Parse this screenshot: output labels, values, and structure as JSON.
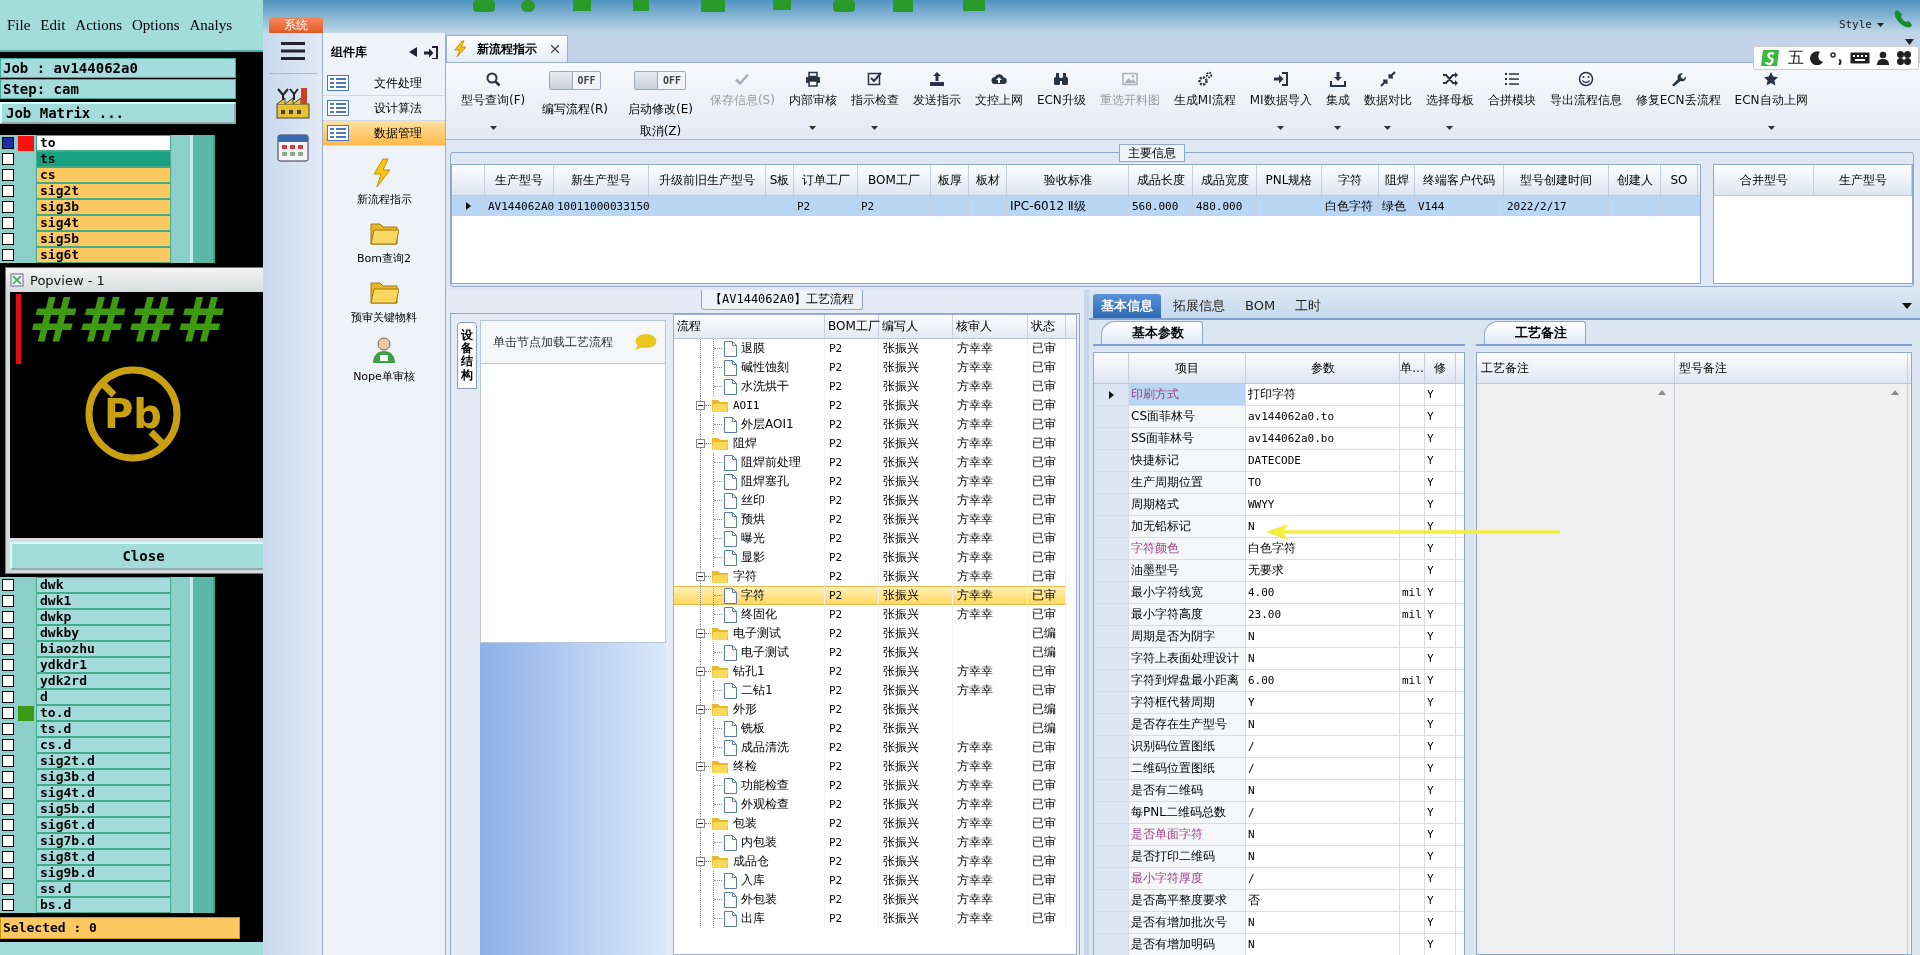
{
  "genesis": {
    "menu": [
      "File",
      "Edit",
      "Actions",
      "Options",
      "Analys"
    ],
    "job": "Job : av144062a0",
    "step": "Step: cam",
    "matrix_button": "Job Matrix ...",
    "layers_top": [
      {
        "label": "to",
        "color": "#ffffff",
        "marker": {
          "color": "#ff1010"
        },
        "selected": true
      },
      {
        "label": "ts",
        "color": "#18a080",
        "selected": false
      },
      {
        "label": "cs",
        "color": "#ffc860",
        "selected": false
      },
      {
        "label": "sig2t",
        "color": "#ffc860",
        "selected": false
      },
      {
        "label": "sig3b",
        "color": "#ffc860",
        "selected": false
      },
      {
        "label": "sig4t",
        "color": "#ffc860",
        "selected": false
      },
      {
        "label": "sig5b",
        "color": "#ffc860",
        "selected": false
      },
      {
        "label": "sig6t",
        "color": "#ffc860",
        "selected": false
      }
    ],
    "popview": {
      "title": "Popview - 1",
      "marks": "####",
      "symbol": "Pb",
      "close": "Close"
    },
    "layers_bottom": [
      {
        "label": "dwk",
        "color": "#a4dcdc",
        "selected": false
      },
      {
        "label": "dwk1",
        "color": "#a4dcdc",
        "selected": false
      },
      {
        "label": "dwkp",
        "color": "#a4dcdc",
        "selected": false
      },
      {
        "label": "dwkby",
        "color": "#a4dcdc",
        "selected": false
      },
      {
        "label": "biaozhu",
        "color": "#a4dcdc",
        "selected": false
      },
      {
        "label": "ydkdr1",
        "color": "#a4dcdc",
        "selected": false
      },
      {
        "label": "ydk2rd",
        "color": "#a4dcdc",
        "selected": false
      },
      {
        "label": "d",
        "color": "#a4dcdc",
        "selected": false
      },
      {
        "label": "to.d",
        "color": "#a4dcdc",
        "marker": {
          "color": "#3a9a18"
        },
        "selected": false
      },
      {
        "label": "ts.d",
        "color": "#a4dcdc",
        "selected": false
      },
      {
        "label": "cs.d",
        "color": "#a4dcdc",
        "selected": false
      },
      {
        "label": "sig2t.d",
        "color": "#a4dcdc",
        "selected": false
      },
      {
        "label": "sig3b.d",
        "color": "#a4dcdc",
        "selected": false
      },
      {
        "label": "sig4t.d",
        "color": "#a4dcdc",
        "selected": false
      },
      {
        "label": "sig5b.d",
        "color": "#a4dcdc",
        "selected": false
      },
      {
        "label": "sig6t.d",
        "color": "#a4dcdc",
        "selected": false
      },
      {
        "label": "sig7b.d",
        "color": "#a4dcdc",
        "selected": false
      },
      {
        "label": "sig8t.d",
        "color": "#a4dcdc",
        "selected": false
      },
      {
        "label": "sig9b.d",
        "color": "#a4dcdc",
        "selected": false
      },
      {
        "label": "ss.d",
        "color": "#a4dcdc",
        "selected": false
      },
      {
        "label": "bs.d",
        "color": "#a4dcdc",
        "selected": false
      }
    ],
    "status": "Selected : 0"
  },
  "app": {
    "system_tab": "系统",
    "style_menu": "Style",
    "ime_label": "五"
  },
  "sidebar": {
    "title": "组件库",
    "categories": [
      {
        "label": "文件处理",
        "selected": false
      },
      {
        "label": "设计算法",
        "selected": false
      },
      {
        "label": "数据管理",
        "selected": true
      }
    ],
    "tools": [
      {
        "label": "新流程指示",
        "kind": "lightning"
      },
      {
        "label": "Bom查询2",
        "kind": "folder"
      },
      {
        "label": "预审关键物料",
        "kind": "folder"
      },
      {
        "label": "Nope单审核",
        "kind": "person"
      }
    ]
  },
  "document_tab": {
    "label": "新流程指示"
  },
  "toolbar": [
    {
      "kind": "button",
      "label": "型号查询(F)",
      "dropdown": true,
      "disabled": false
    },
    {
      "kind": "toggle",
      "state": "OFF",
      "on": false,
      "label": "编写流程(R)"
    },
    {
      "kind": "toggle",
      "state": "OFF",
      "on": false,
      "label": "启动修改(E)",
      "label2": "取消(Z)"
    },
    {
      "kind": "button",
      "label": "保存信息(S)",
      "dropdown": false,
      "disabled": true
    },
    {
      "kind": "button",
      "label": "内部审核",
      "dropdown": true,
      "disabled": false
    },
    {
      "kind": "button",
      "label": "指示检查",
      "dropdown": true,
      "disabled": false
    },
    {
      "kind": "button",
      "label": "发送指示",
      "dropdown": false,
      "disabled": false
    },
    {
      "kind": "button",
      "label": "文控上网",
      "dropdown": false,
      "disabled": false
    },
    {
      "kind": "button",
      "label": "ECN升级",
      "dropdown": false,
      "disabled": false
    },
    {
      "kind": "button",
      "label": "重选开料图",
      "dropdown": false,
      "disabled": true
    },
    {
      "kind": "button",
      "label": "生成MI流程",
      "dropdown": false,
      "disabled": false
    },
    {
      "kind": "button",
      "label": "MI数据导入",
      "dropdown": true,
      "disabled": false
    },
    {
      "kind": "button",
      "label": "集成",
      "dropdown": true,
      "disabled": false
    },
    {
      "kind": "button",
      "label": "数据对比",
      "dropdown": true,
      "disabled": false
    },
    {
      "kind": "button",
      "label": "选择母板",
      "dropdown": true,
      "disabled": false
    },
    {
      "kind": "button",
      "label": "合拼模块",
      "dropdown": false,
      "disabled": false
    },
    {
      "kind": "button",
      "label": "导出流程信息",
      "dropdown": false,
      "disabled": false
    },
    {
      "kind": "button",
      "label": "修复ECN丢流程",
      "dropdown": false,
      "disabled": false
    },
    {
      "kind": "button",
      "label": "ECN自动上网",
      "dropdown": true,
      "disabled": false
    }
  ],
  "main_info": {
    "title": "主要信息",
    "columns": [
      "生产型号",
      "新生产型号",
      "升级前旧生产型号",
      "S板",
      "订单工厂",
      "BOM工厂",
      "板厚",
      "板材",
      "验收标准",
      "成品长度",
      "成品宽度",
      "PNL规格",
      "字符",
      "阻焊",
      "终端客户代码",
      "型号创建时间",
      "创建人",
      "SO"
    ],
    "rows": [
      {
        "selected": true,
        "cells": [
          "AV144062A0",
          "10011000033150",
          null,
          null,
          "P2",
          "P2",
          null,
          null,
          "IPC-6012 Ⅱ级",
          "560.000",
          "480.000",
          null,
          "白色字符",
          "绿色",
          "V144",
          "2022/2/17",
          null,
          null
        ]
      }
    ],
    "side_columns": [
      "合并型号",
      "生产型号"
    ]
  },
  "flow": {
    "title": "【AV144062A0】工艺流程",
    "side_tab": "设备结构",
    "hint": "单击节点加载工艺流程",
    "columns": [
      "流程",
      "BOM工厂",
      "编写人",
      "核审人",
      "状态"
    ],
    "tree": [
      {
        "kind": "offscreen-parent",
        "children": [
          {
            "kind": "file",
            "label": "退膜",
            "bom": "P2",
            "writer": "张振兴",
            "reviewer": "方幸幸",
            "status": "已审",
            "selected": false
          },
          {
            "kind": "file",
            "label": "碱性蚀刻",
            "bom": "P2",
            "writer": "张振兴",
            "reviewer": "方幸幸",
            "status": "已审",
            "selected": false
          },
          {
            "kind": "file",
            "label": "水洗烘干",
            "bom": "P2",
            "writer": "张振兴",
            "reviewer": "方幸幸",
            "status": "已审",
            "selected": false
          }
        ]
      },
      {
        "kind": "folder",
        "label": "AOI1",
        "bom": "P2",
        "writer": "张振兴",
        "reviewer": "方幸幸",
        "status": "已审",
        "selected": false,
        "expanded": true,
        "children": [
          {
            "kind": "file",
            "label": "外层AOI1",
            "bom": "P2",
            "writer": "张振兴",
            "reviewer": "方幸幸",
            "status": "已审",
            "selected": false
          }
        ]
      },
      {
        "kind": "folder",
        "label": "阻焊",
        "bom": "P2",
        "writer": "张振兴",
        "reviewer": "方幸幸",
        "status": "已审",
        "selected": false,
        "expanded": true,
        "children": [
          {
            "kind": "file",
            "label": "阻焊前处理",
            "bom": "P2",
            "writer": "张振兴",
            "reviewer": "方幸幸",
            "status": "已审",
            "selected": false
          },
          {
            "kind": "file",
            "label": "阻焊塞孔",
            "bom": "P2",
            "writer": "张振兴",
            "reviewer": "方幸幸",
            "status": "已审",
            "selected": false
          },
          {
            "kind": "file",
            "label": "丝印",
            "bom": "P2",
            "writer": "张振兴",
            "reviewer": "方幸幸",
            "status": "已审",
            "selected": false
          },
          {
            "kind": "file",
            "label": "预烘",
            "bom": "P2",
            "writer": "张振兴",
            "reviewer": "方幸幸",
            "status": "已审",
            "selected": false
          },
          {
            "kind": "file",
            "label": "曝光",
            "bom": "P2",
            "writer": "张振兴",
            "reviewer": "方幸幸",
            "status": "已审",
            "selected": false
          },
          {
            "kind": "file",
            "label": "显影",
            "bom": "P2",
            "writer": "张振兴",
            "reviewer": "方幸幸",
            "status": "已审",
            "selected": false
          }
        ]
      },
      {
        "kind": "folder",
        "label": "字符",
        "bom": "P2",
        "writer": "张振兴",
        "reviewer": "方幸幸",
        "status": "已审",
        "selected": false,
        "expanded": true,
        "children": [
          {
            "kind": "file",
            "label": "字符",
            "bom": "P2",
            "writer": "张振兴",
            "reviewer": "方幸幸",
            "status": "已审",
            "selected": true
          },
          {
            "kind": "file",
            "label": "终固化",
            "bom": "P2",
            "writer": "张振兴",
            "reviewer": "方幸幸",
            "status": "已审",
            "selected": false
          }
        ]
      },
      {
        "kind": "folder",
        "label": "电子测试",
        "bom": "P2",
        "writer": "张振兴",
        "status": "已编",
        "selected": false,
        "expanded": true,
        "children": [
          {
            "kind": "file",
            "label": "电子测试",
            "bom": "P2",
            "writer": "张振兴",
            "status": "已编",
            "selected": false
          }
        ]
      },
      {
        "kind": "folder",
        "label": "钻孔1",
        "bom": "P2",
        "writer": "张振兴",
        "reviewer": "方幸幸",
        "status": "已审",
        "selected": false,
        "expanded": true,
        "children": [
          {
            "kind": "file",
            "label": "二钻1",
            "bom": "P2",
            "writer": "张振兴",
            "reviewer": "方幸幸",
            "status": "已审",
            "selected": false
          }
        ]
      },
      {
        "kind": "folder",
        "label": "外形",
        "bom": "P2",
        "writer": "张振兴",
        "status": "已编",
        "selected": false,
        "expanded": true,
        "children": [
          {
            "kind": "file",
            "label": "铣板",
            "bom": "P2",
            "writer": "张振兴",
            "status": "已编",
            "selected": false
          },
          {
            "kind": "file",
            "label": "成品清洗",
            "bom": "P2",
            "writer": "张振兴",
            "reviewer": "方幸幸",
            "status": "已审",
            "selected": false
          }
        ]
      },
      {
        "kind": "folder",
        "label": "终检",
        "bom": "P2",
        "writer": "张振兴",
        "reviewer": "方幸幸",
        "status": "已审",
        "selected": false,
        "expanded": true,
        "children": [
          {
            "kind": "file",
            "label": "功能检查",
            "bom": "P2",
            "writer": "张振兴",
            "reviewer": "方幸幸",
            "status": "已审",
            "selected": false
          },
          {
            "kind": "file",
            "label": "外观检查",
            "bom": "P2",
            "writer": "张振兴",
            "reviewer": "方幸幸",
            "status": "已审",
            "selected": false
          }
        ]
      },
      {
        "kind": "folder",
        "label": "包装",
        "bom": "P2",
        "writer": "张振兴",
        "reviewer": "方幸幸",
        "status": "已审",
        "selected": false,
        "expanded": true,
        "children": [
          {
            "kind": "file",
            "label": "内包装",
            "bom": "P2",
            "writer": "张振兴",
            "reviewer": "方幸幸",
            "status": "已审",
            "selected": false
          }
        ]
      },
      {
        "kind": "folder",
        "label": "成品仓",
        "bom": "P2",
        "writer": "张振兴",
        "reviewer": "方幸幸",
        "status": "已审",
        "selected": false,
        "expanded": true,
        "children": [
          {
            "kind": "file",
            "label": "入库",
            "bom": "P2",
            "writer": "张振兴",
            "reviewer": "方幸幸",
            "status": "已审",
            "selected": false
          },
          {
            "kind": "file",
            "label": "外包装",
            "bom": "P2",
            "writer": "张振兴",
            "reviewer": "方幸幸",
            "status": "已审",
            "selected": false
          },
          {
            "kind": "file",
            "label": "出库",
            "bom": "P2",
            "writer": "张振兴",
            "reviewer": "方幸幸",
            "status": "已审",
            "selected": false
          }
        ]
      }
    ]
  },
  "params": {
    "tabs": [
      {
        "label": "基本信息",
        "selected": true
      },
      {
        "label": "拓展信息",
        "selected": false
      },
      {
        "label": "BOM",
        "selected": false
      },
      {
        "label": "工时",
        "selected": false
      }
    ],
    "subtab": "基本参数",
    "columns": [
      "项目",
      "参数",
      "单...",
      "修"
    ],
    "rows": [
      {
        "item": "印刷方式",
        "value": "打印字符",
        "mod": "Y",
        "emphasis": true,
        "selected": true
      },
      {
        "item": "CS面菲林号",
        "value": "av144062a0.to",
        "mod": "Y",
        "emphasis": false,
        "selected": false
      },
      {
        "item": "SS面菲林号",
        "value": "av144062a0.bo",
        "mod": "Y",
        "emphasis": false,
        "selected": false
      },
      {
        "item": "快捷标记",
        "value": "DATECODE",
        "mod": "Y",
        "emphasis": false,
        "selected": false
      },
      {
        "item": "生产周期位置",
        "value": "TO",
        "mod": "Y",
        "emphasis": false,
        "selected": false
      },
      {
        "item": "周期格式",
        "value": "WWYY",
        "mod": "Y",
        "emphasis": false,
        "selected": false
      },
      {
        "item": "加无铅标记",
        "value": "N",
        "mod": "Y",
        "emphasis": false,
        "selected": false
      },
      {
        "item": "字符颜色",
        "value": "白色字符",
        "mod": "Y",
        "emphasis": true,
        "selected": false
      },
      {
        "item": "油墨型号",
        "value": "无要求",
        "mod": "Y",
        "emphasis": false,
        "selected": false
      },
      {
        "item": "最小字符线宽",
        "value": "4.00",
        "unit": "mil",
        "mod": "Y",
        "emphasis": false,
        "selected": false
      },
      {
        "item": "最小字符高度",
        "value": "23.00",
        "unit": "mil",
        "mod": "Y",
        "emphasis": false,
        "selected": false
      },
      {
        "item": "周期是否为阴字",
        "value": "N",
        "mod": "Y",
        "emphasis": false,
        "selected": false
      },
      {
        "item": "字符上表面处理设计",
        "value": "N",
        "mod": "Y",
        "emphasis": false,
        "selected": false
      },
      {
        "item": "字符到焊盘最小距离",
        "value": "6.00",
        "unit": "mil",
        "mod": "Y",
        "emphasis": false,
        "selected": false
      },
      {
        "item": "字符框代替周期",
        "value": "Y",
        "mod": "Y",
        "emphasis": false,
        "selected": false
      },
      {
        "item": "是否存在生产型号",
        "value": "N",
        "mod": "Y",
        "emphasis": false,
        "selected": false
      },
      {
        "item": "识别码位置图纸",
        "value": "/",
        "mod": "Y",
        "emphasis": false,
        "selected": false
      },
      {
        "item": "二维码位置图纸",
        "value": "/",
        "mod": "Y",
        "emphasis": false,
        "selected": false
      },
      {
        "item": "是否有二维码",
        "value": "N",
        "mod": "Y",
        "emphasis": false,
        "selected": false
      },
      {
        "item": "每PNL二维码总数",
        "value": "/",
        "mod": "Y",
        "emphasis": false,
        "selected": false
      },
      {
        "item": "是否单面字符",
        "value": "N",
        "mod": "Y",
        "emphasis": true,
        "selected": false
      },
      {
        "item": "是否打印二维码",
        "value": "N",
        "mod": "Y",
        "emphasis": false,
        "selected": false
      },
      {
        "item": "最小字符厚度",
        "value": "/",
        "mod": "Y",
        "emphasis": true,
        "selected": false
      },
      {
        "item": "是否高平整度要求",
        "value": "否",
        "mod": "Y",
        "emphasis": false,
        "selected": false
      },
      {
        "item": "是否有增加批次号",
        "value": "N",
        "mod": "Y",
        "emphasis": false,
        "selected": false
      },
      {
        "item": "是否有增加明码",
        "value": "N",
        "mod": "Y",
        "emphasis": false,
        "selected": false
      }
    ],
    "notes": {
      "tab": "工艺备注",
      "columns": [
        "工艺备注",
        "型号备注"
      ]
    }
  }
}
